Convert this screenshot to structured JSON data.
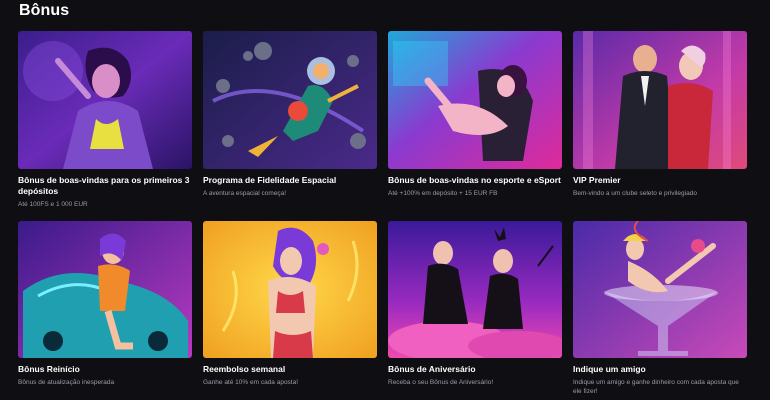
{
  "page": {
    "title": "Bônus"
  },
  "cards": [
    {
      "title": "Bônus de boas-vindas para os primeiros 3 depósitos",
      "desc": "Até 100FS e 1 000 EUR",
      "image": "neon-woman-purple"
    },
    {
      "title": "Programa de Fidelidade Espacial",
      "desc": "A aventura espacial começa!",
      "image": "astronaut-space"
    },
    {
      "title": "Bônus de boas-vindas no esporte e eSport",
      "desc": "Até +100% em depósito + 15 EUR FB",
      "image": "gamer-woman-chair"
    },
    {
      "title": "VIP Premier",
      "desc": "Bem-vindo a um clube seleto e privilegiado",
      "image": "vip-couple"
    },
    {
      "title": "Bônus Reinício",
      "desc": "Bônus de atualização inesperada",
      "image": "woman-car"
    },
    {
      "title": "Reembolso semanal",
      "desc": "Ganhe até 10% em cada aposta!",
      "image": "woman-yellow"
    },
    {
      "title": "Bônus de Aniversário",
      "desc": "Receba o seu Bônus de Aniversário!",
      "image": "two-women-pink"
    },
    {
      "title": "Indique um amigo",
      "desc": "Indique um amigo e ganhe dinheiro com cada aposta que ele fizer!",
      "image": "woman-cocktail-glass"
    }
  ]
}
